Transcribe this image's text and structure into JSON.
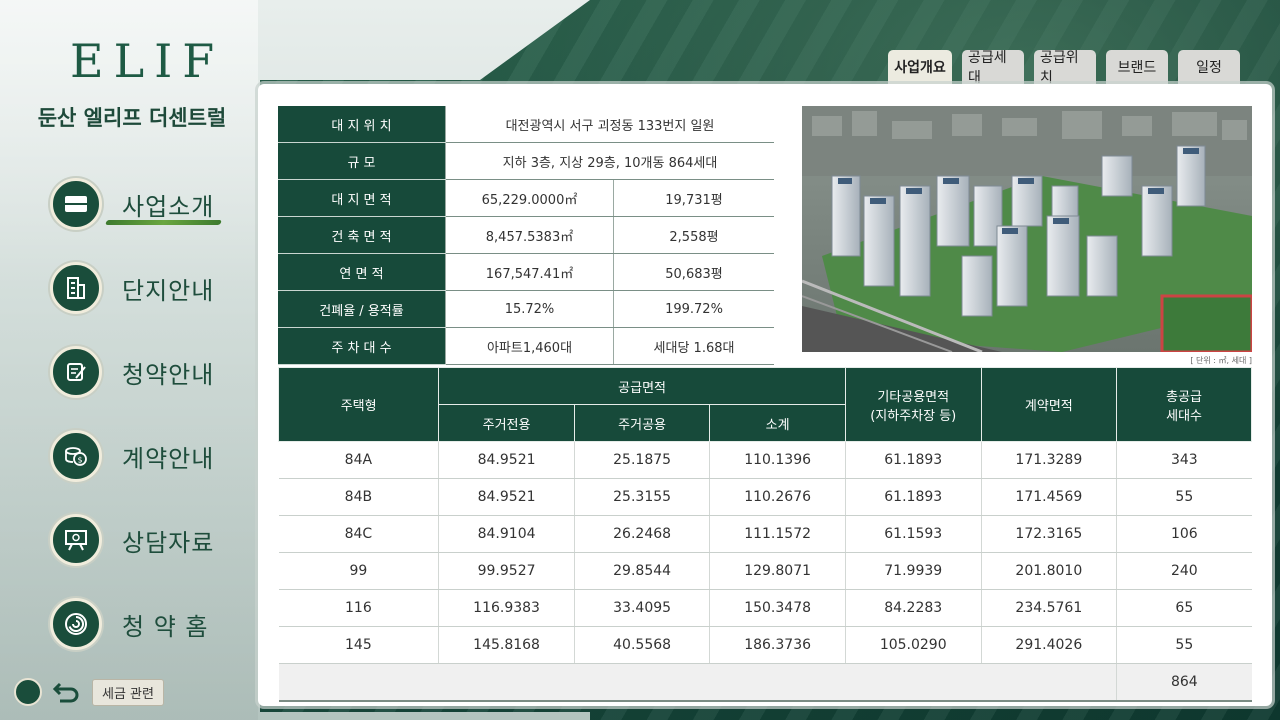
{
  "brand": {
    "logo": "ELIF",
    "title": "둔산 엘리프 더센트럴"
  },
  "nav": [
    {
      "label": "사업소개",
      "icon": "folder-icon",
      "active": true
    },
    {
      "label": "단지안내",
      "icon": "building-icon"
    },
    {
      "label": "청약안내",
      "icon": "document-edit-icon"
    },
    {
      "label": "계약안내",
      "icon": "coins-icon"
    },
    {
      "label": "상담자료",
      "icon": "presentation-board-icon"
    },
    {
      "label": "청 약 홈",
      "icon": "swirl-logo-icon"
    }
  ],
  "footer": {
    "tax_label": "세금 관련"
  },
  "tabs": [
    {
      "label": "사업개요",
      "active": true
    },
    {
      "label": "공급세대"
    },
    {
      "label": "공급위치"
    },
    {
      "label": "브랜드"
    },
    {
      "label": "일정"
    }
  ],
  "overview": [
    {
      "header": "대 지 위 치",
      "value": "대전광역시 서구 괴정동 133번지 일원"
    },
    {
      "header": "규 모",
      "value": "지하 3층, 지상 29층, 10개동 864세대"
    },
    {
      "header": "대 지 면 적",
      "value1": "65,229.0000㎡",
      "value2": "19,731평"
    },
    {
      "header": "건 축 면 적",
      "value1": "8,457.5383㎡",
      "value2": "2,558평"
    },
    {
      "header": "연 면 적",
      "value1": "167,547.41㎡",
      "value2": "50,683평"
    },
    {
      "header": "건폐율 / 용적률",
      "value1": "15.72%",
      "value2": "199.72%"
    },
    {
      "header": "주 차 대 수",
      "value1": "아파트1,460대",
      "value2": "세대당 1.68대"
    }
  ],
  "unit_note": "[ 단위 : ㎡, 세대 ]",
  "supply": {
    "headers": {
      "type": "주택형",
      "supply_area": "공급면적",
      "exclusive": "주거전용",
      "common": "주거공용",
      "subtotal": "소계",
      "other_common_1": "기타공용면적",
      "other_common_2": "(지하주차장 등)",
      "contract": "계약면적",
      "households_1": "총공급",
      "households_2": "세대수"
    },
    "rows": [
      {
        "type": "84A",
        "exclusive": "84.9521",
        "common": "25.1875",
        "subtotal": "110.1396",
        "other": "61.1893",
        "contract": "171.3289",
        "units": "343"
      },
      {
        "type": "84B",
        "exclusive": "84.9521",
        "common": "25.3155",
        "subtotal": "110.2676",
        "other": "61.1893",
        "contract": "171.4569",
        "units": "55"
      },
      {
        "type": "84C",
        "exclusive": "84.9104",
        "common": "26.2468",
        "subtotal": "111.1572",
        "other": "61.1593",
        "contract": "172.3165",
        "units": "106"
      },
      {
        "type": "99",
        "exclusive": "99.9527",
        "common": "29.8544",
        "subtotal": "129.8071",
        "other": "71.9939",
        "contract": "201.8010",
        "units": "240"
      },
      {
        "type": "116",
        "exclusive": "116.9383",
        "common": "33.4095",
        "subtotal": "150.3478",
        "other": "84.2283",
        "contract": "234.5761",
        "units": "65"
      },
      {
        "type": "145",
        "exclusive": "145.8168",
        "common": "40.5568",
        "subtotal": "186.3736",
        "other": "105.0290",
        "contract": "291.4026",
        "units": "55"
      }
    ],
    "total_units": "864"
  }
}
